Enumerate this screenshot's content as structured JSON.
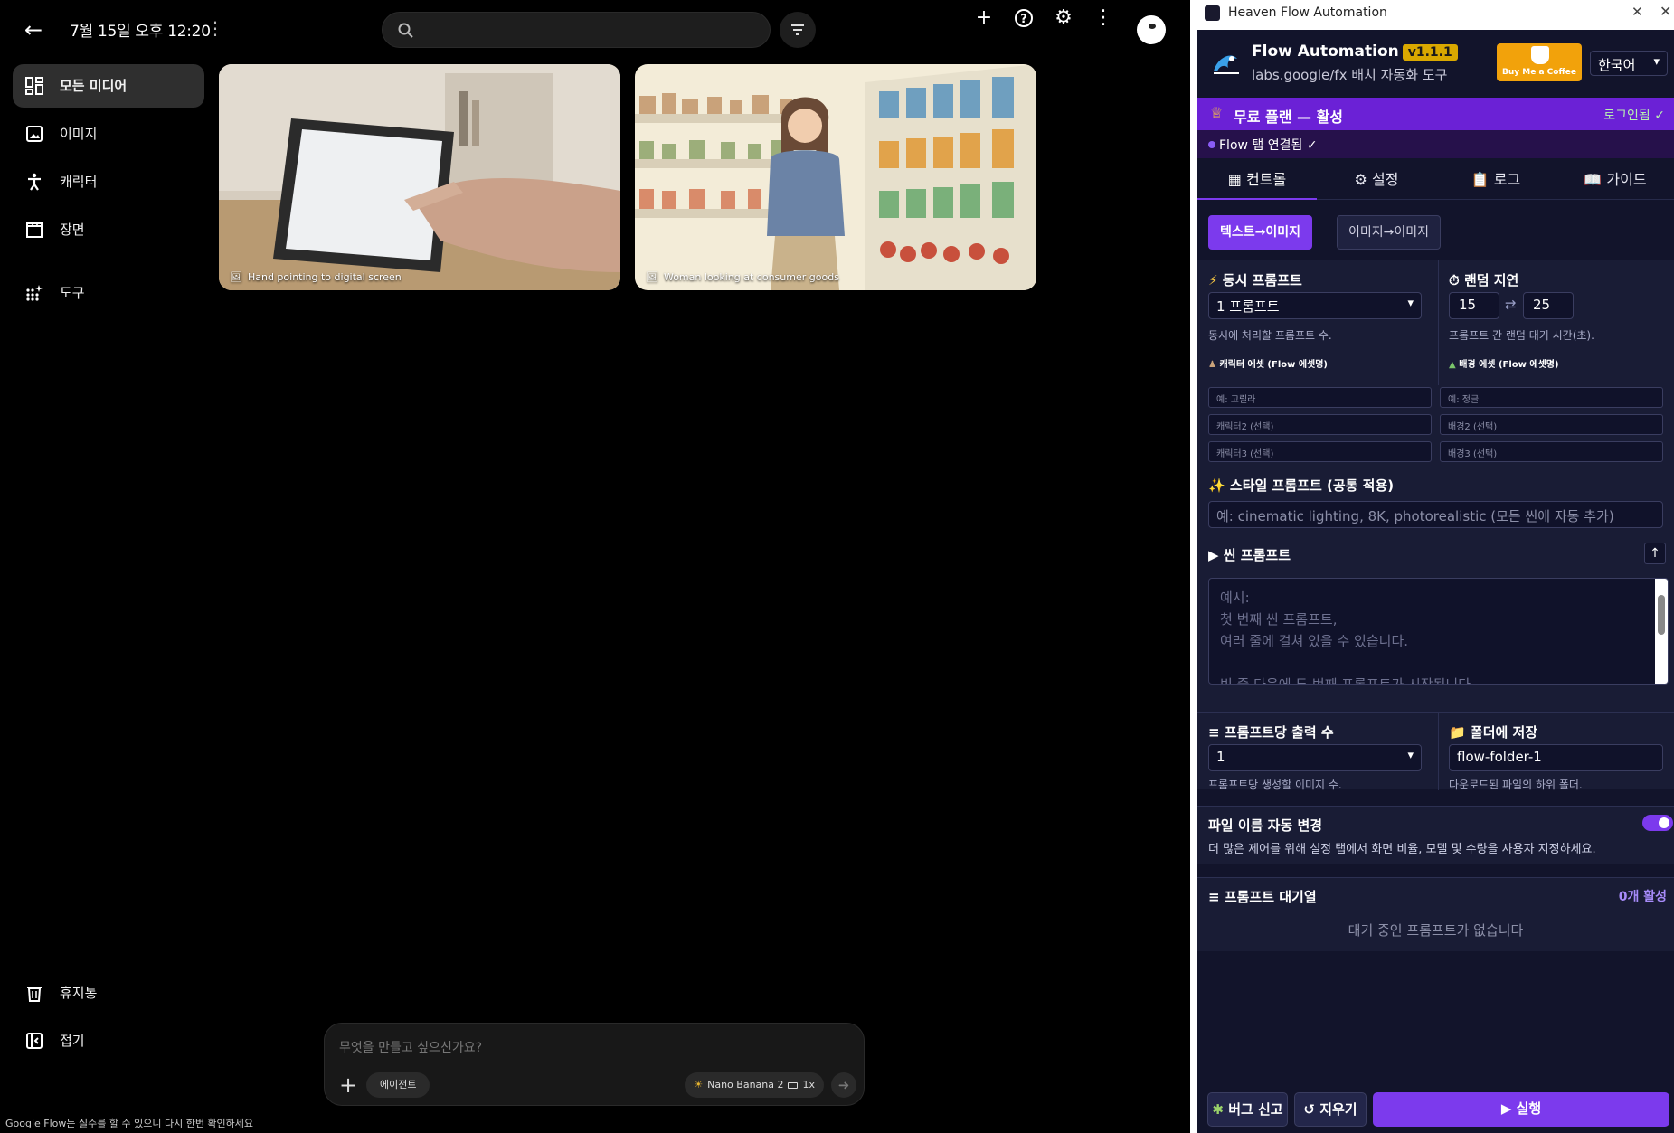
{
  "header": {
    "title": "7월 15일 오후 12:20",
    "search_placeholder": ""
  },
  "sidebar": {
    "items": [
      {
        "label": "모든 미디어",
        "icon": "grid-icon",
        "active": true
      },
      {
        "label": "이미지",
        "icon": "image-icon"
      },
      {
        "label": "캐릭터",
        "icon": "person-icon"
      },
      {
        "label": "장면",
        "icon": "clapperboard-icon"
      },
      {
        "label": "도구",
        "icon": "tools-icon"
      }
    ],
    "bottom": [
      {
        "label": "휴지통",
        "icon": "trash-icon"
      },
      {
        "label": "접기",
        "icon": "collapse-icon"
      }
    ]
  },
  "media": [
    {
      "caption": "Hand pointing to digital screen"
    },
    {
      "caption": "Woman looking at consumer goods"
    }
  ],
  "composer": {
    "placeholder": "무엇을 만들고 싶으신가요?",
    "agent_label": "에이전트",
    "model_label": "Nano Banana 2",
    "count_label": "1x"
  },
  "disclaimer": "Google Flow는 실수를 할 수 있으니 다시 한번 확인하세요",
  "extension": {
    "window_title": "Heaven Flow Automation",
    "brand": "Flow Automation",
    "version": "v1.1.1",
    "subtitle": "labs.google/fx 배치 자동화 도구",
    "coffee_label": "Buy Me a Coffee",
    "language": "한국어",
    "plan_text": "무료 플랜 — 활성",
    "login_text": "로그인됨 ✓",
    "connection_text": "Flow 탭 연결됨 ✓",
    "tabs": [
      "컨트롤",
      "설정",
      "로그",
      "가이드"
    ],
    "modes": [
      "텍스트→이미지",
      "이미지→이미지"
    ],
    "concurrent": {
      "label": "동시 프롬프트",
      "value": "1 프롬프트",
      "help": "동시에 처리할 프롬프트 수."
    },
    "delay": {
      "label": "랜덤 지연",
      "min": "15",
      "max": "25",
      "help": "프롬프트 간 랜덤 대기 시간(초)."
    },
    "character_assets": {
      "label": "캐릭터 에셋 (Flow 에셋명)",
      "placeholders": [
        "예: 고릴라",
        "캐릭터2 (선택)",
        "캐릭터3 (선택)"
      ]
    },
    "background_assets": {
      "label": "배경 에셋 (Flow 에셋명)",
      "placeholders": [
        "예: 정글",
        "배경2 (선택)",
        "배경3 (선택)"
      ]
    },
    "style_prompt": {
      "label": "스타일 프롬프트 (공통 적용)",
      "placeholder": "예: cinematic lighting, 8K, photorealistic (모든 씬에 자동 추가)"
    },
    "scene_prompt": {
      "label": "씬 프롬프트",
      "placeholder": "예시:\n첫 번째 씬 프롬프트,\n여러 줄에 걸쳐 있을 수 있습니다.\n\n빈 줄 다음에 두 번째 프롬프트가 시작됩니다."
    },
    "outputs": {
      "label": "프롬프트당 출력 수",
      "value": "1",
      "help": "프롬프트당 생성할 이미지 수."
    },
    "folder": {
      "label": "폴더에 저장",
      "value": "flow-folder-1",
      "help": "다운로드된 파일의 하위 폴더."
    },
    "auto_rename": {
      "label": "파일 이름 자동 변경",
      "enabled": true,
      "help": "더 많은 제어를 위해 설정 탭에서 화면 비율, 모델 및 수량을 사용자 지정하세요."
    },
    "queue": {
      "label": "프롬프트 대기열",
      "active_count": "0개 활성",
      "empty_text": "대기 중인 프롬프트가 없습니다"
    },
    "footer": {
      "bug_label": "버그 신고",
      "clear_label": "지우기",
      "run_label": "▶ 실행"
    },
    "colors": {
      "accent": "#7c3aed",
      "plan_bar": "#6b21d6",
      "panel_bg": "#12142b",
      "version_badge": "#d9a800",
      "coffee": "#f2a20b"
    }
  }
}
